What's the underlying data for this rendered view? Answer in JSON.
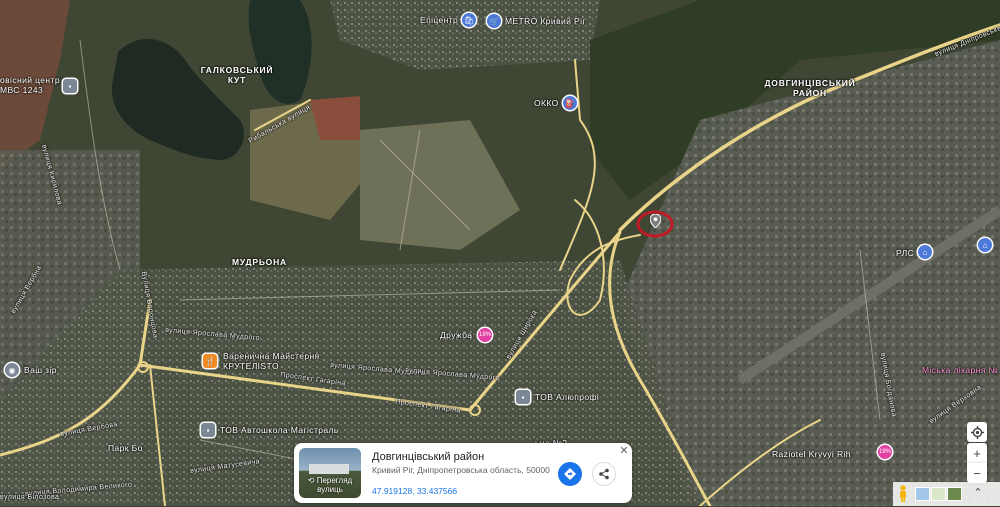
{
  "map": {
    "area_labels": [
      {
        "key": "galkovskyi",
        "text": "ГАЛКОВСЬКИЙ КУТ"
      },
      {
        "key": "dovhyntsivskyi",
        "text": "ДОВГИНЦІВСЬКИЙ РАЙОН"
      },
      {
        "key": "mudrona",
        "text": "МУДРЬОНА"
      }
    ],
    "poi_labels": {
      "epicenter": "Епіцентр",
      "metro": "METRO Кривий Ріг",
      "okko": "ОККО",
      "mvs": "овісний центр МВС 1243",
      "druzhba": "Дружба",
      "varenychna": "Варенична Майстерня КРУТЕЛІSTO",
      "aliuprofi": "ТОВ Алюпрофі",
      "avtoshkola": "ТОВ Автошкола Магістраль",
      "vash_zir": "Ваш зір",
      "park": "Парк Бо",
      "raziotel": "Raziotel Kryvyi Rih",
      "rlo": "РЛС",
      "likarnia": "Міська лікарня №",
      "obscured": "ьна №2"
    },
    "street_labels": {
      "dniprovske": "вулиця Дніпровське шосе",
      "yaroslava1": "вулиця Ярослава Мудрого",
      "yaroslava2": "вулиця Ярослава Мудрого",
      "yaroslava3": "вулиця Ярослава Мудрого",
      "prospekt": "Проспект Гагаріна",
      "prospekt2": "Проспект Гагаріна",
      "vorontsova": "Вулиця Воронцова",
      "verbova": "вулиця Вербова",
      "volodymyra": "вулиця Володимира Великого",
      "matusevycha": "вулиця Матусевича",
      "bilosova": "вулиця Білозова",
      "verbna": "вулиця Вербна",
      "kirilova": "вулиця Кирилова",
      "verkhni": "вулиця Верховна",
      "ryba": "Рибальська вулиця",
      "shyroka": "вулиця Широка",
      "bohdanivka": "вулиця Богданова"
    }
  },
  "card": {
    "title": "Довгинцівський район",
    "subtitle": "Кривий Ріг, Дніпропетровська область, 50000",
    "coords": "47.919128, 33.437566",
    "thumb_label": "Перегляд вулиць"
  },
  "colors": {
    "road": "#e9d48a",
    "marker_ring": "#c01c28",
    "accent": "#1a73e8"
  }
}
